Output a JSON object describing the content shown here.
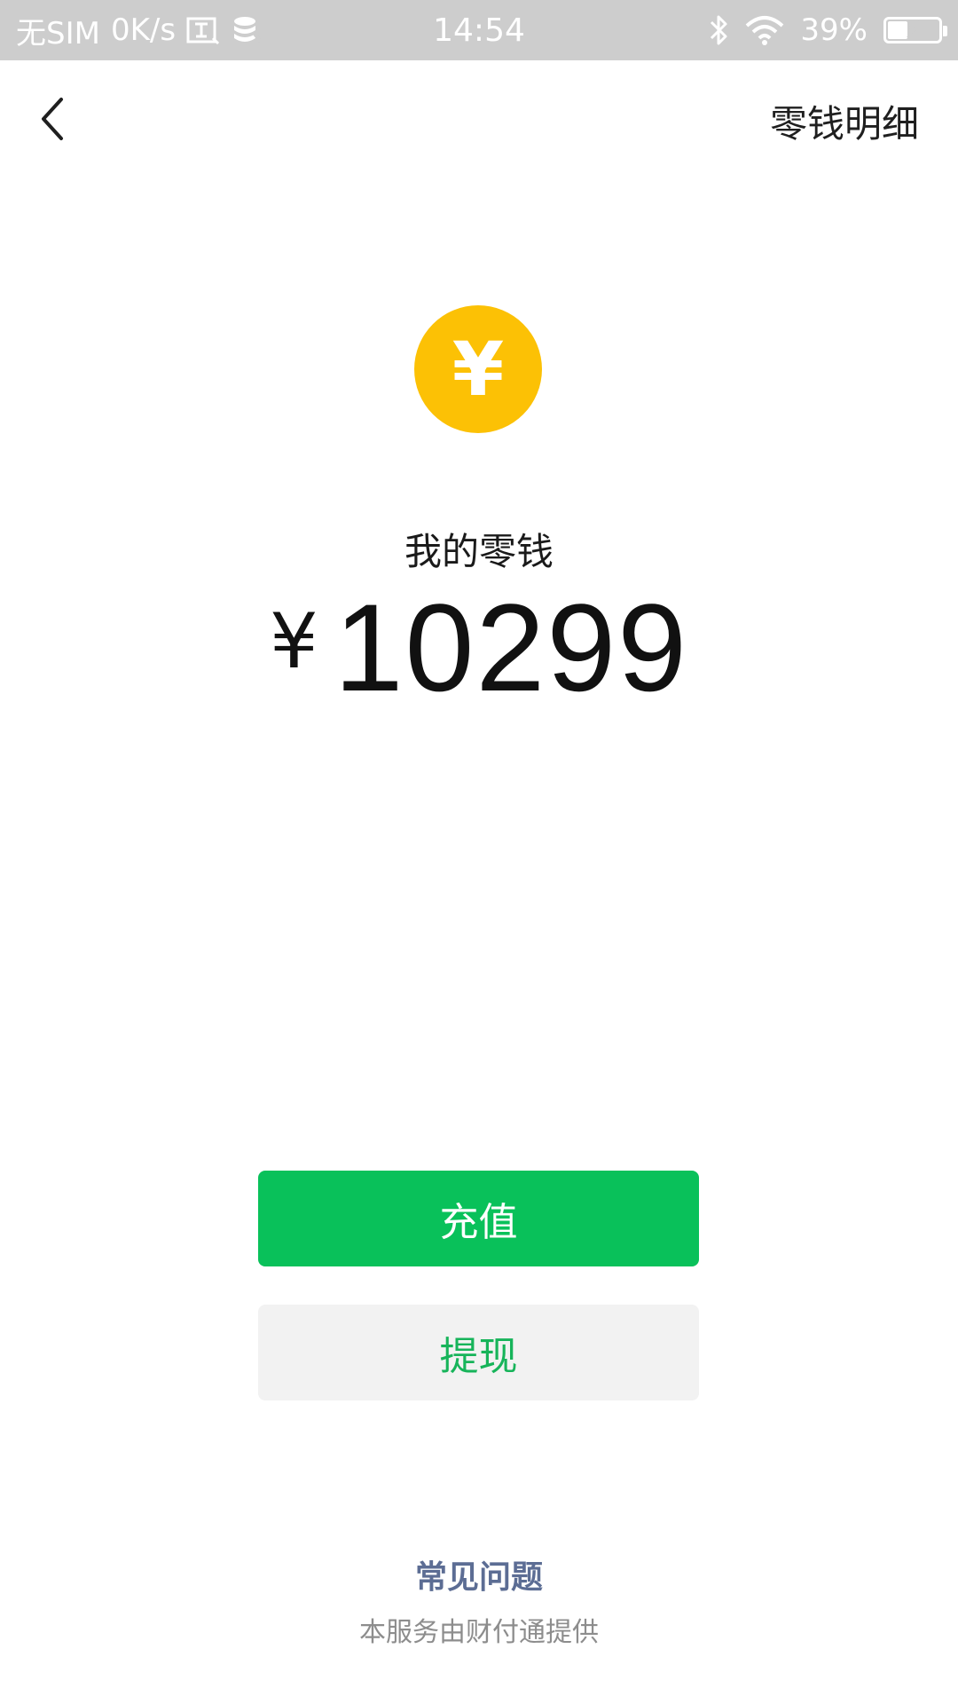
{
  "status_bar": {
    "sim": "无SIM",
    "net_speed": "0K/s",
    "time": "14:54",
    "battery_percent": "39%",
    "battery_level": 0.39,
    "icons": [
      "screenshot-icon",
      "database-icon",
      "bluetooth-icon",
      "wifi-icon",
      "battery-icon"
    ]
  },
  "nav": {
    "back_icon": "chevron-left-icon",
    "detail_label": "零钱明细"
  },
  "balance": {
    "coin_icon": "yuan-coin-icon",
    "coin_symbol": "¥",
    "label": "我的零钱",
    "currency_sign": "¥",
    "amount": "10299"
  },
  "actions": {
    "recharge_label": "充值",
    "withdraw_label": "提现"
  },
  "footer": {
    "faq_label": "常见问题",
    "provider_note": "本服务由财付通提供"
  },
  "colors": {
    "status_bar_bg": "#cdcdcd",
    "coin": "#fcc105",
    "primary_green": "#09c15a",
    "withdraw_text": "#17b45a",
    "withdraw_bg": "#f2f2f2",
    "faq_link": "#5c6d94",
    "muted_text": "#8d8d8d"
  }
}
